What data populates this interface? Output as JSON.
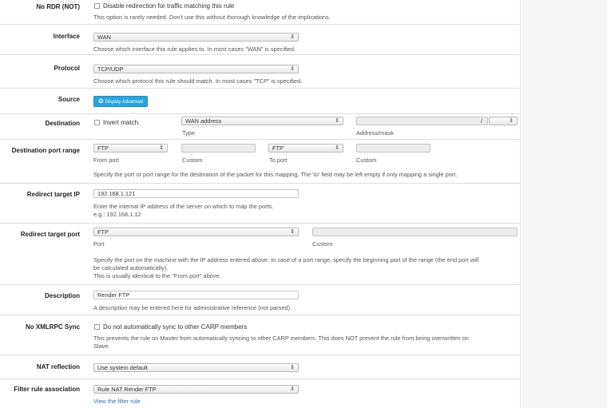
{
  "no_rdr": {
    "label": "No RDR (NOT)",
    "checkbox_label": "Disable redirection for traffic matching this rule",
    "help": "This option is rarely needed. Don't use this without thorough knowledge of the implications."
  },
  "interface": {
    "label": "Interface",
    "value": "WAN",
    "help": "Choose which interface this rule applies to. In most cases \"WAN\" is specified."
  },
  "protocol": {
    "label": "Protocol",
    "value": "TCP/UDP",
    "help": "Choose which protocol this rule should match. In most cases \"TCP\" is specified."
  },
  "source": {
    "label": "Source",
    "button": "Display Advanced"
  },
  "destination": {
    "label": "Destination",
    "invert_label": "Invert match.",
    "type_value": "WAN address",
    "type_caption": "Type",
    "address_caption": "Address/mask",
    "slash": "/"
  },
  "dest_port": {
    "label": "Destination port range",
    "from_value": "FTP",
    "from_caption": "From port",
    "custom_caption": "Custom",
    "to_value": "FTP",
    "to_caption": "To port",
    "custom2_caption": "Custom",
    "help": "Specify the port or port range for the destination of the packet for this mapping. The 'to' field may be left empty if only mapping a single port."
  },
  "redirect_ip": {
    "label": "Redirect target IP",
    "value": "192.168.1.121",
    "help1": "Enter the internal IP address of the server on which to map the ports.",
    "help2": "e.g.: 192.168.1.12"
  },
  "redirect_port": {
    "label": "Redirect target port",
    "value": "FTP",
    "port_caption": "Port",
    "custom_caption": "Custom",
    "help1": "Specify the port on the machine with the IP address entered above. In case of a port range, specify the beginning port of the range (the end port will",
    "help2": "be calculated automatically).",
    "help3": "This is usually identical to the \"From port\" above."
  },
  "description": {
    "label": "Description",
    "value": "Render FTP",
    "help": "A description may be entered here for administrative reference (not parsed)."
  },
  "xmlrpc": {
    "label": "No XMLRPC Sync",
    "checkbox_label": "Do not automatically sync to other CARP members",
    "help1": "This prevents the rule on Master from automatically syncing to other CARP members. This does NOT prevent the rule from being overwritten on",
    "help2": "Slave."
  },
  "nat_reflection": {
    "label": "NAT reflection",
    "value": "Use system default"
  },
  "filter_rule": {
    "label": "Filter rule association",
    "value": "Rule NAT Render FTP",
    "link": "View the filter rule"
  },
  "icons": {
    "select_arrow": "⇕",
    "gear": "✿"
  }
}
